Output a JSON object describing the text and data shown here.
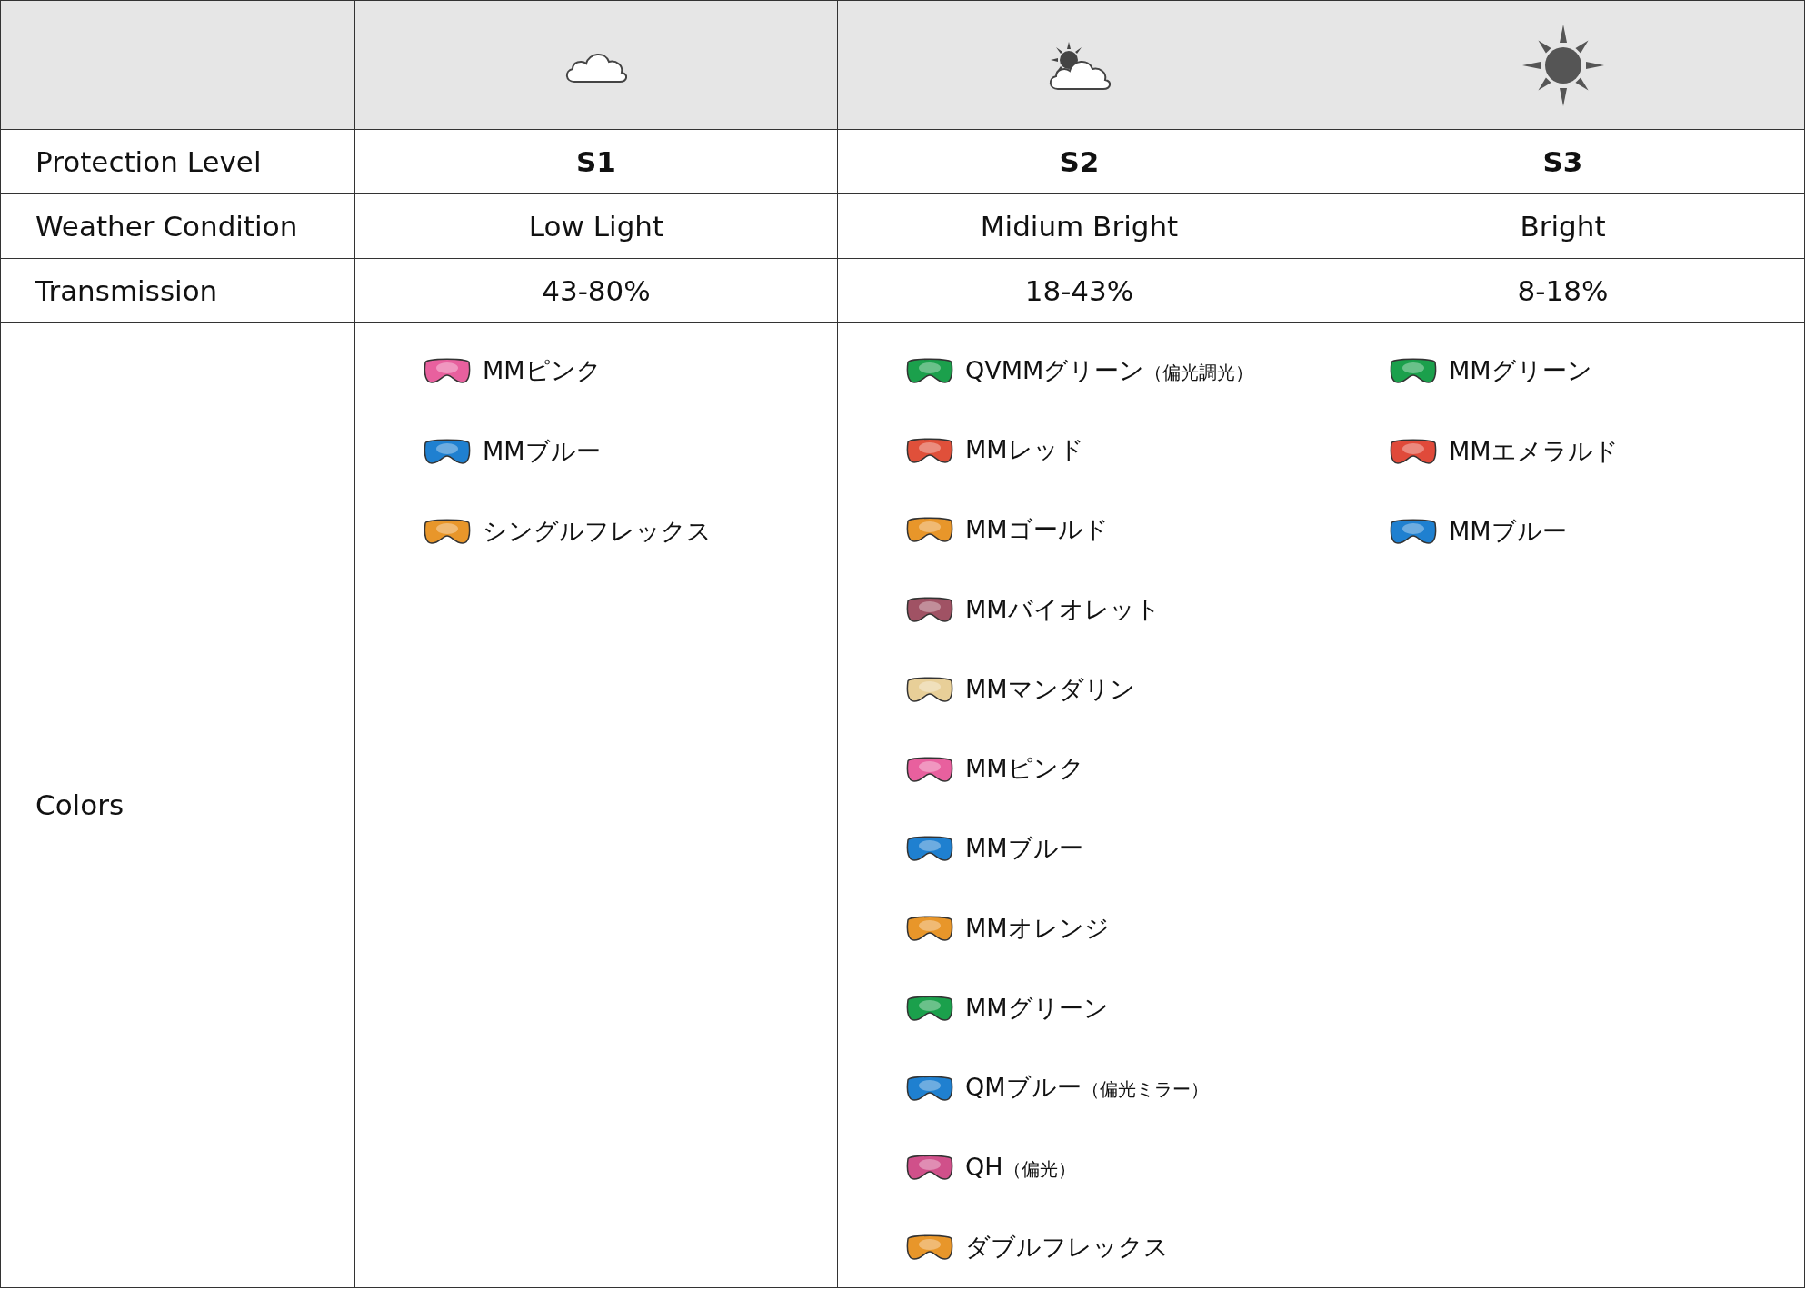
{
  "header": {
    "columns": [
      {
        "kind": "empty"
      },
      {
        "kind": "cloud"
      },
      {
        "kind": "sun-cloud"
      },
      {
        "kind": "sun"
      }
    ]
  },
  "rows": [
    {
      "label": "Protection Level",
      "bold": true,
      "values": [
        "S1",
        "S2",
        "S3"
      ]
    },
    {
      "label": "Weather Condition",
      "bold": false,
      "values": [
        "Low Light",
        "Midium Bright",
        "Bright"
      ]
    },
    {
      "label": "Transmission",
      "bold": false,
      "values": [
        "43-80%",
        "18-43%",
        "8-18%"
      ]
    }
  ],
  "colors": {
    "label": "Colors",
    "columns": [
      [
        {
          "name": "MMピンク",
          "color": "#e8609e"
        },
        {
          "name": "MMブルー",
          "color": "#1f80d0"
        },
        {
          "name": "シングルフレックス",
          "color": "#e8962a"
        }
      ],
      [
        {
          "name": "QVMMグリーン",
          "note": "（偏光調光）",
          "color": "#1ba04c"
        },
        {
          "name": "MMレッド",
          "color": "#e0503a"
        },
        {
          "name": "MMゴールド",
          "color": "#e8962a"
        },
        {
          "name": "MMバイオレット",
          "color": "#a05264"
        },
        {
          "name": "MMマンダリン",
          "color": "#e8cf98"
        },
        {
          "name": "MMピンク",
          "color": "#e8609e"
        },
        {
          "name": "MMブルー",
          "color": "#1f80d0"
        },
        {
          "name": "MMオレンジ",
          "color": "#e8962a"
        },
        {
          "name": "MMグリーン",
          "color": "#1ba04c"
        },
        {
          "name": "QMブルー",
          "note": "（偏光ミラー）",
          "color": "#1f80d0"
        },
        {
          "name": "QH",
          "note": "（偏光）",
          "color": "#d0508a"
        },
        {
          "name": "ダブルフレックス",
          "color": "#e8962a"
        }
      ],
      [
        {
          "name": "MMグリーン",
          "color": "#1ba04c"
        },
        {
          "name": "MMエメラルド",
          "color": "#e04a3a"
        },
        {
          "name": "MMブルー",
          "color": "#1f80d0"
        }
      ]
    ]
  }
}
